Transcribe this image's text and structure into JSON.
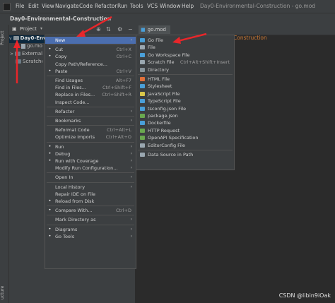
{
  "window_title": "Day0-Environmental-Construction - go.mod",
  "menubar": [
    "File",
    "Edit",
    "View",
    "Navigate",
    "Code",
    "Refactor",
    "Run",
    "Tools",
    "VCS",
    "Window",
    "Help"
  ],
  "breadcrumb": "Day0-Environmental-Construction",
  "side_labels": {
    "project": "Project",
    "structure": "ucture"
  },
  "project_panel": {
    "title": "Project",
    "tree": [
      "Day0-Envi",
      "go.mo",
      "External",
      "Scratche"
    ]
  },
  "editor": {
    "tab": "go.mod",
    "line1": "Construction"
  },
  "context_menu": [
    {
      "label": "New",
      "shortcut": "",
      "submenu": true,
      "selected": true
    },
    {
      "sep": true
    },
    {
      "label": "Cut",
      "shortcut": "Ctrl+X",
      "icon": "cut-icon"
    },
    {
      "label": "Copy",
      "shortcut": "Ctrl+C",
      "icon": "copy-icon"
    },
    {
      "label": "Copy Path/Reference...",
      "shortcut": ""
    },
    {
      "label": "Paste",
      "shortcut": "Ctrl+V",
      "icon": "paste-icon"
    },
    {
      "sep": true
    },
    {
      "label": "Find Usages",
      "shortcut": "Alt+F7"
    },
    {
      "label": "Find in Files...",
      "shortcut": "Ctrl+Shift+F"
    },
    {
      "label": "Replace in Files...",
      "shortcut": "Ctrl+Shift+R"
    },
    {
      "label": "Inspect Code...",
      "shortcut": ""
    },
    {
      "sep": true
    },
    {
      "label": "Refactor",
      "shortcut": "",
      "submenu": true
    },
    {
      "sep": true
    },
    {
      "label": "Bookmarks",
      "shortcut": "",
      "submenu": true
    },
    {
      "sep": true
    },
    {
      "label": "Reformat Code",
      "shortcut": "Ctrl+Alt+L"
    },
    {
      "label": "Optimize Imports",
      "shortcut": "Ctrl+Alt+O"
    },
    {
      "sep": true
    },
    {
      "label": "Run",
      "shortcut": "",
      "submenu": true,
      "icon": "run-icon"
    },
    {
      "label": "Debug",
      "shortcut": "",
      "submenu": true,
      "icon": "debug-icon"
    },
    {
      "label": "Run with Coverage",
      "shortcut": "",
      "submenu": true,
      "icon": "coverage-icon"
    },
    {
      "label": "Modify Run Configuration...",
      "shortcut": "",
      "submenu": true
    },
    {
      "sep": true
    },
    {
      "label": "Open In",
      "shortcut": "",
      "submenu": true
    },
    {
      "sep": true
    },
    {
      "label": "Local History",
      "shortcut": "",
      "submenu": true
    },
    {
      "label": "Repair IDE on File",
      "shortcut": ""
    },
    {
      "label": "Reload from Disk",
      "shortcut": "",
      "icon": "reload-icon"
    },
    {
      "sep": true
    },
    {
      "label": "Compare With...",
      "shortcut": "Ctrl+D",
      "icon": "compare-icon"
    },
    {
      "sep": true
    },
    {
      "label": "Mark Directory as",
      "shortcut": "",
      "submenu": true
    },
    {
      "sep": true
    },
    {
      "label": "Diagrams",
      "shortcut": "",
      "submenu": true,
      "icon": "diagram-icon"
    },
    {
      "label": "Go Tools",
      "shortcut": "",
      "submenu": true,
      "icon": "gotools-icon"
    }
  ],
  "new_submenu": [
    {
      "label": "Go File",
      "shortcut": "",
      "icon": "go-file-icon",
      "color": "#4a9fd8"
    },
    {
      "label": "File",
      "shortcut": "",
      "icon": "file-icon",
      "color": "#9aa7b0"
    },
    {
      "label": "Go Workspace File",
      "shortcut": "",
      "icon": "go-workspace-icon",
      "color": "#4a9fd8"
    },
    {
      "label": "Scratch File",
      "shortcut": "Ctrl+Alt+Shift+Insert",
      "icon": "scratch-icon",
      "color": "#9aa7b0"
    },
    {
      "label": "Directory",
      "shortcut": "",
      "icon": "directory-icon",
      "color": "#87939a"
    },
    {
      "sep": true
    },
    {
      "label": "HTML File",
      "shortcut": "",
      "icon": "html-icon",
      "color": "#e0703a"
    },
    {
      "label": "Stylesheet",
      "shortcut": "",
      "icon": "css-icon",
      "color": "#4a9fd8"
    },
    {
      "label": "JavaScript File",
      "shortcut": "",
      "icon": "js-icon",
      "color": "#d8c64a"
    },
    {
      "label": "TypeScript File",
      "shortcut": "",
      "icon": "ts-icon",
      "color": "#4a9fd8"
    },
    {
      "label": "tsconfig.json File",
      "shortcut": "",
      "icon": "tsconfig-icon",
      "color": "#4a9fd8"
    },
    {
      "label": "package.json",
      "shortcut": "",
      "icon": "package-json-icon",
      "color": "#6aa84f"
    },
    {
      "label": "Dockerfile",
      "shortcut": "",
      "icon": "docker-icon",
      "color": "#4a9fd8"
    },
    {
      "label": "HTTP Request",
      "shortcut": "",
      "icon": "http-icon",
      "color": "#6aa84f"
    },
    {
      "label": "OpenAPI Specification",
      "shortcut": "",
      "icon": "openapi-icon",
      "color": "#6aa84f"
    },
    {
      "label": "EditorConfig File",
      "shortcut": "",
      "icon": "editorconfig-icon",
      "color": "#9aa7b0"
    },
    {
      "sep": true
    },
    {
      "label": "Data Source in Path",
      "shortcut": "",
      "icon": "datasource-icon",
      "color": "#9aa7b0"
    }
  ],
  "watermark": "CSDN @libin9iOak"
}
